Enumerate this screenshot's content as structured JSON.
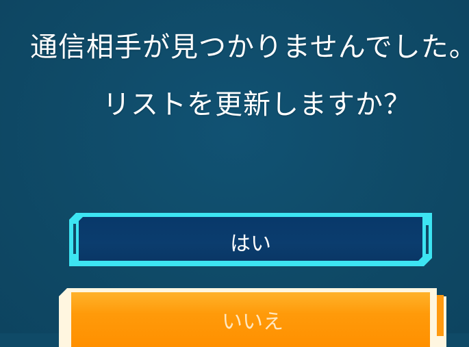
{
  "dialog": {
    "message_line1": "通信相手が見つかりませんでした。",
    "message_line2": "リストを更新しますか？",
    "yes_label": "はい",
    "no_label": "いいえ"
  },
  "colors": {
    "background": "#0f4a67",
    "yes_frame": "#3de4f2",
    "yes_fill": "#0b3d6e",
    "no_fill": "#ff9a0a"
  }
}
